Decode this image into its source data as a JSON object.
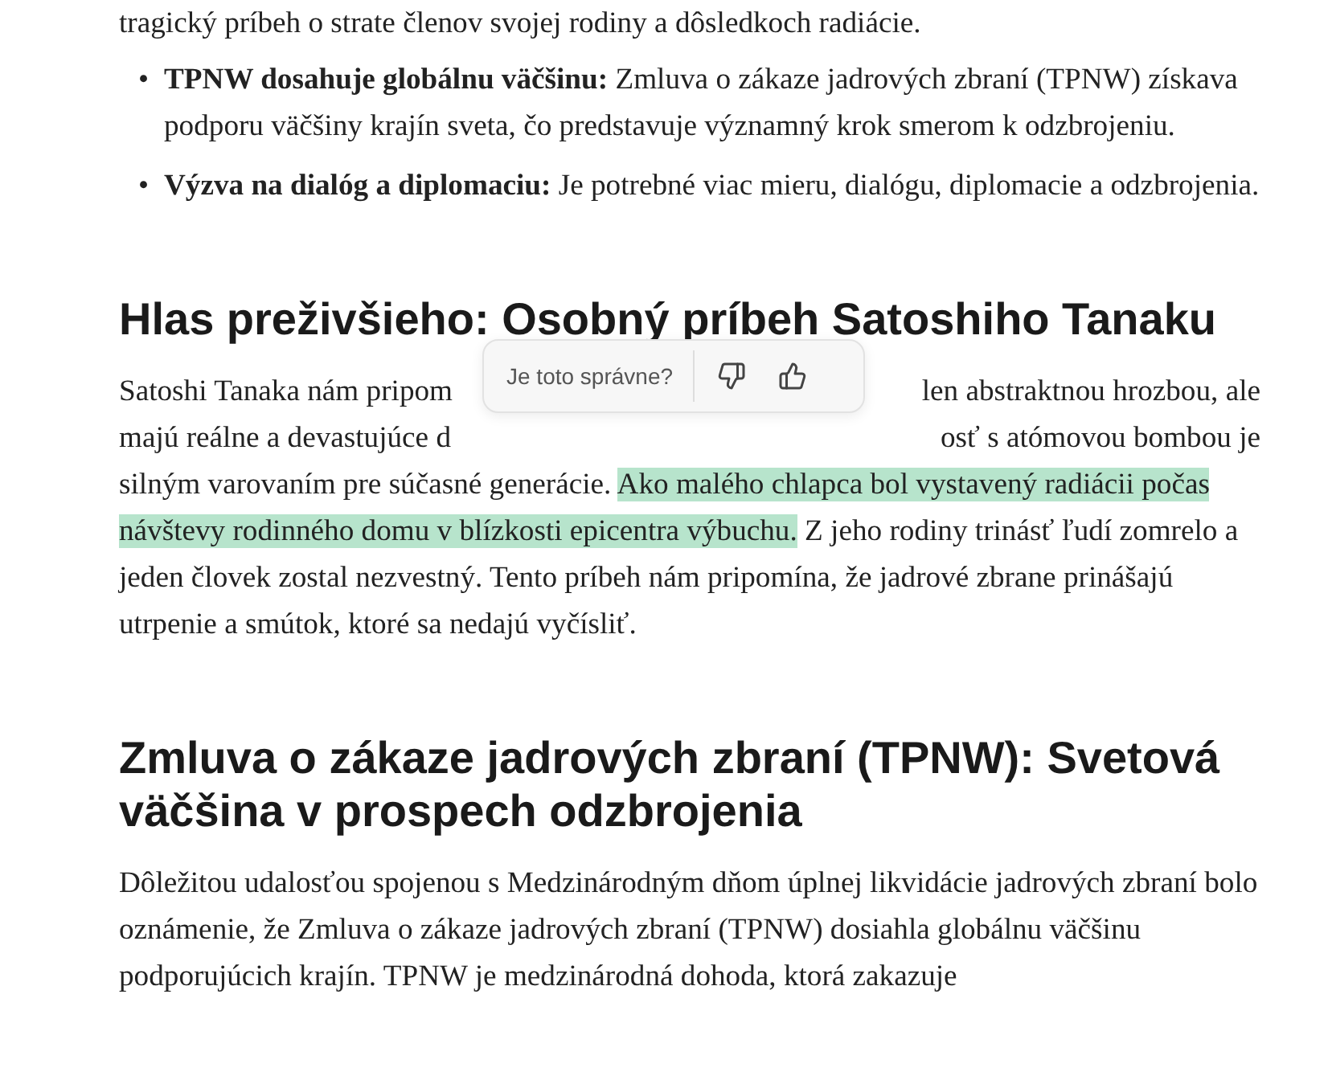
{
  "cut_line": "tragický príbeh o strate členov svojej rodiny a dôsledkoch radiácie.",
  "bullets": [
    {
      "marker": "•",
      "text": "**TPNW dosahuje globálnu väčšinu:** Zmluva o zákaze jadrových zbraní (TPNW) získava podporu väčšiny krajín sveta, čo predstavuje významný krok smerom k odzbrojeniu."
    },
    {
      "marker": "•",
      "text": "**Výzva na dialóg a diplomaciu:** Je potrebné viac mieru, dialógu, diplomacie a odzbrojenia."
    }
  ],
  "sections": [
    {
      "heading": "Hlas preživšieho: Osobný príbeh Satoshiho Tanaku",
      "covered_lines": [
        {
          "left": "Satoshi Tanaka nám pripom",
          "right": "len abstraktnou hrozbou, ale"
        },
        {
          "left": "majú reálne a devastujúce d",
          "right": "osť s atómovou bombou je"
        }
      ],
      "segments": [
        {
          "text": "silným varovaním pre súčasné generácie. ",
          "highlighted": false
        },
        {
          "text": "Ako malého chlapca bol vystavený radiácii počas návštevy rodinného domu v blízkosti epicentra výbuchu.",
          "highlighted": true
        },
        {
          "text": " Z jeho rodiny trinásť ľudí zomrelo a jeden človek zostal nezvestný. Tento príbeh nám pripomína, že jadrové zbrane prinášajú utrpenie a smútok, ktoré sa nedajú vyčísliť.",
          "highlighted": false
        }
      ],
      "feedback": {
        "question": "Je toto správne?"
      }
    },
    {
      "heading": "Zmluva o zákaze jadrových zbraní (TPNW): Svetová väčšina v prospech odzbrojenia",
      "segments": [
        {
          "text": "Dôležitou udalosťou spojenou s Medzinárodným dňom úplnej likvidácie jadrových zbraní bolo oznámenie, že Zmluva o zákaze jadrových zbraní (TPNW) dosiahla globálnu väčšinu podporujúcich krajín. TPNW je medzinárodná dohoda, ktorá zakazuje",
          "highlighted": false
        }
      ]
    }
  ]
}
